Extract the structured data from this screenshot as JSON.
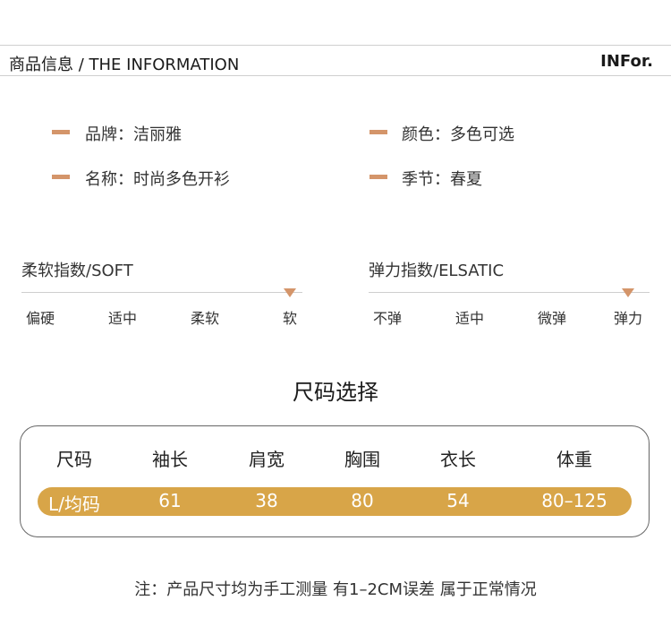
{
  "header": {
    "title": "商品信息 / THE INFORMATION",
    "right_label": "INFor."
  },
  "info": {
    "brand": "品牌：洁丽雅",
    "color": "颜色：多色可选",
    "name": "名称：时尚多色开衫",
    "season": "季节：春夏"
  },
  "soft_scale": {
    "title": "柔软指数/SOFT",
    "options": [
      "偏硬",
      "适中",
      "柔软",
      "软"
    ],
    "selected_index": 3
  },
  "elastic_scale": {
    "title": "弹力指数/ELSATIC",
    "options": [
      "不弹",
      "适中",
      "微弹",
      "弹力"
    ],
    "selected_index": 3
  },
  "size_section": {
    "title": "尺码选择",
    "headers": [
      "尺码",
      "袖长",
      "肩宽",
      "胸围",
      "衣长",
      "体重"
    ],
    "row": [
      "L/均码",
      "61",
      "38",
      "80",
      "54",
      "80–125"
    ]
  },
  "note": "注：产品尺寸均为手工测量 有1–2CM误差 属于正常情况",
  "colors": {
    "accent": "#d4956a",
    "size_bar": "#d8a548"
  }
}
